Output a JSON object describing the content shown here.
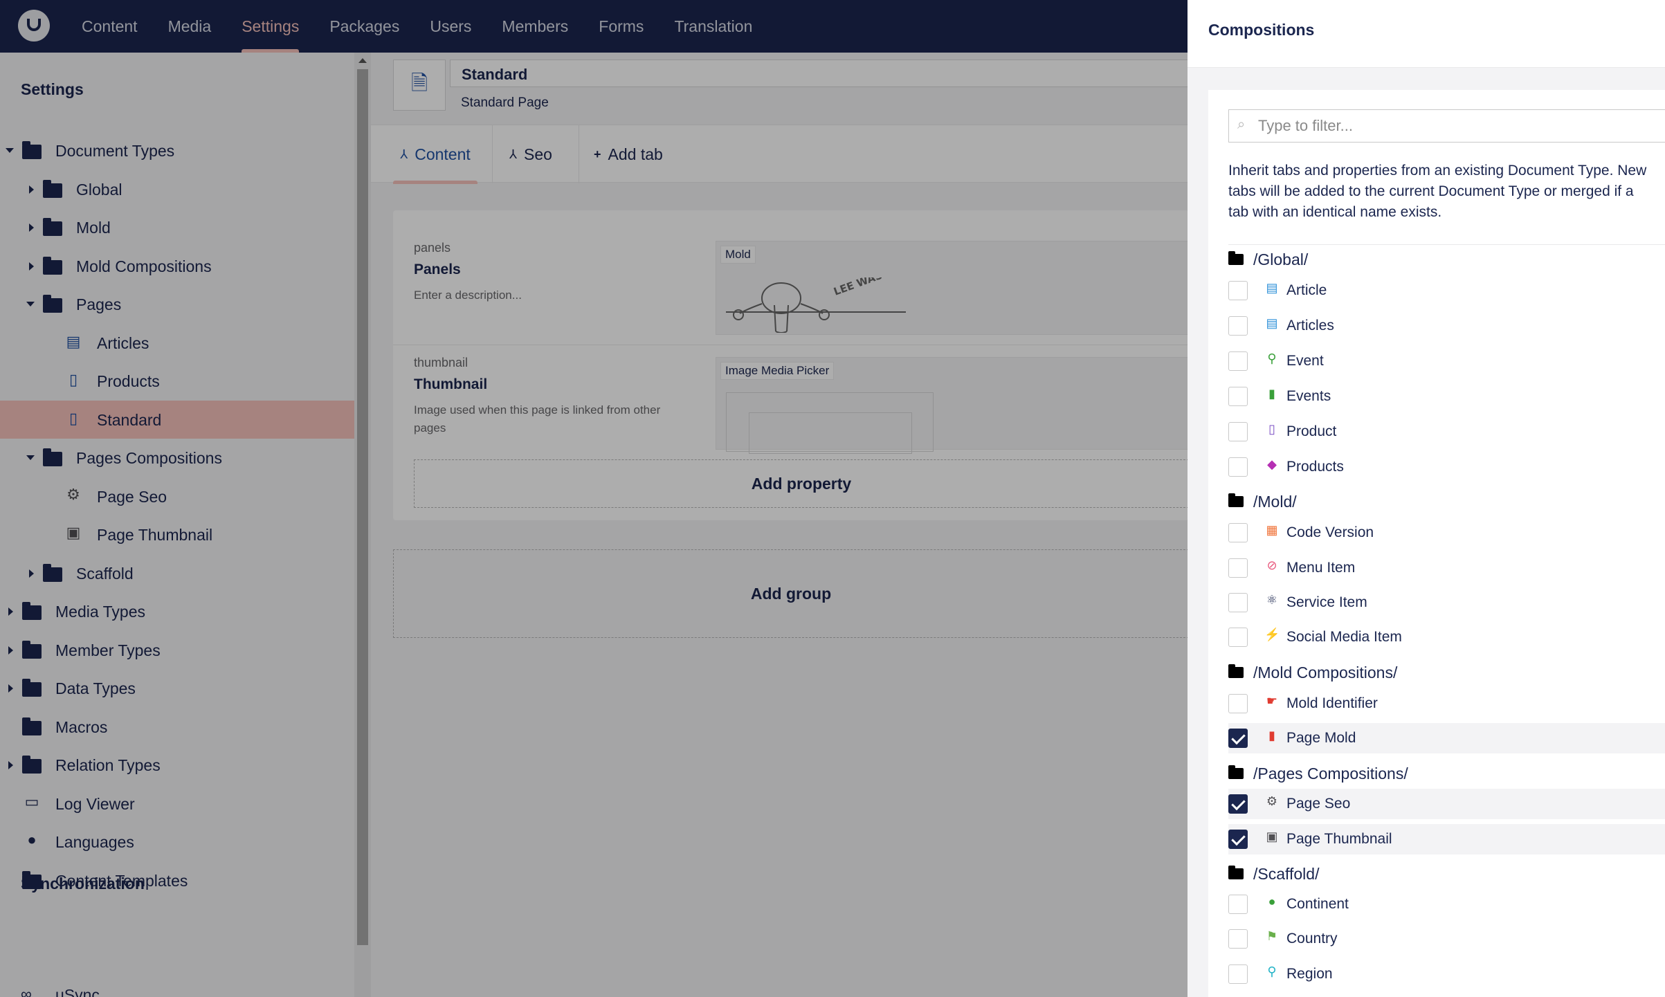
{
  "topnav": {
    "items": [
      {
        "label": "Content"
      },
      {
        "label": "Media"
      },
      {
        "label": "Settings"
      },
      {
        "label": "Packages"
      },
      {
        "label": "Users"
      },
      {
        "label": "Members"
      },
      {
        "label": "Forms"
      },
      {
        "label": "Translation"
      }
    ],
    "active": "Settings"
  },
  "sidebar": {
    "title": "Settings",
    "tree": [
      {
        "label": "Document Types",
        "icon": "folder-icon",
        "expanded": true
      },
      {
        "label": "Global",
        "icon": "folder-icon",
        "expanded": false
      },
      {
        "label": "Mold",
        "icon": "folder-icon",
        "expanded": false
      },
      {
        "label": "Mold Compositions",
        "icon": "folder-icon",
        "expanded": false
      },
      {
        "label": "Pages",
        "icon": "folder-icon",
        "expanded": true
      },
      {
        "label": "Articles",
        "icon": "newspaper-icon"
      },
      {
        "label": "Products",
        "icon": "document-icon"
      },
      {
        "label": "Standard",
        "icon": "document-icon",
        "selected": true
      },
      {
        "label": "Pages Compositions",
        "icon": "folder-icon",
        "expanded": true
      },
      {
        "label": "Page Seo",
        "icon": "gear-icon"
      },
      {
        "label": "Page Thumbnail",
        "icon": "picture-icon"
      },
      {
        "label": "Scaffold",
        "icon": "folder-icon",
        "expanded": false
      },
      {
        "label": "Media Types",
        "icon": "folder-icon",
        "expanded": false
      },
      {
        "label": "Member Types",
        "icon": "folder-icon",
        "expanded": false
      },
      {
        "label": "Data Types",
        "icon": "folder-icon",
        "expanded": false
      },
      {
        "label": "Macros",
        "icon": "folder-icon"
      },
      {
        "label": "Relation Types",
        "icon": "folder-icon",
        "expanded": false
      },
      {
        "label": "Log Viewer",
        "icon": "box-icon"
      },
      {
        "label": "Languages",
        "icon": "globe-icon"
      },
      {
        "label": "Content Templates",
        "icon": "folder-icon"
      }
    ],
    "sync_title": "Synchronization",
    "usync": "uSync"
  },
  "editor": {
    "name": "Standard",
    "alias": "Standard Page",
    "tabs": [
      {
        "label": "Content"
      },
      {
        "label": "Seo"
      },
      {
        "label": "Add tab"
      }
    ],
    "properties": [
      {
        "alias": "panels",
        "name": "Panels",
        "description": "Enter a description...",
        "editor": "Mold",
        "doodle": "LEE WAS HERE"
      },
      {
        "alias": "thumbnail",
        "name": "Thumbnail",
        "description": "Image used when this page is linked from other pages",
        "editor": "Image Media Picker"
      }
    ],
    "add_property": "Add property",
    "add_group": "Add group"
  },
  "panel": {
    "title": "Compositions",
    "filter_placeholder": "Type to filter...",
    "intro": "Inherit tabs and properties from an existing Document Type. New tabs will be added to the current Document Type or merged if a tab with an identical name exists.",
    "groups": [
      {
        "name": "/Global/",
        "items": [
          {
            "label": "Article",
            "icon": "newspaper-icon",
            "color": "#2b8fd8",
            "checked": false
          },
          {
            "label": "Articles",
            "icon": "newspaper-icon",
            "color": "#2b8fd8",
            "checked": false
          },
          {
            "label": "Event",
            "icon": "map-pin-icon",
            "color": "#3aa03a",
            "checked": false
          },
          {
            "label": "Events",
            "icon": "calendar-icon",
            "color": "#3aa03a",
            "checked": false
          },
          {
            "label": "Product",
            "icon": "document-icon",
            "color": "#7b4fc4",
            "checked": false
          },
          {
            "label": "Products",
            "icon": "tags-icon",
            "color": "#b52fb3",
            "checked": false
          }
        ]
      },
      {
        "name": "/Mold/",
        "items": [
          {
            "label": "Code Version",
            "icon": "grid-icon",
            "color": "#f0743a",
            "checked": false
          },
          {
            "label": "Menu Item",
            "icon": "paperclip-icon",
            "color": "#e8577c",
            "checked": false
          },
          {
            "label": "Service Item",
            "icon": "atom-icon",
            "color": "#1b264f",
            "checked": false
          },
          {
            "label": "Social Media Item",
            "icon": "satellite-icon",
            "color": "#e8577c",
            "checked": false
          }
        ]
      },
      {
        "name": "/Mold Compositions/",
        "items": [
          {
            "label": "Mold Identifier",
            "icon": "hand-icon",
            "color": "#e03c31",
            "checked": false
          },
          {
            "label": "Page Mold",
            "icon": "book-icon",
            "color": "#e03c31",
            "checked": true
          }
        ]
      },
      {
        "name": "/Pages Compositions/",
        "items": [
          {
            "label": "Page Seo",
            "icon": "gear-icon",
            "color": "#515054",
            "checked": true
          },
          {
            "label": "Page Thumbnail",
            "icon": "picture-icon",
            "color": "#515054",
            "checked": true
          }
        ]
      },
      {
        "name": "/Scaffold/",
        "items": [
          {
            "label": "Continent",
            "icon": "globe-icon",
            "color": "#3aa03a",
            "checked": false
          },
          {
            "label": "Country",
            "icon": "flag-icon",
            "color": "#6ab04c",
            "checked": false
          },
          {
            "label": "Region",
            "icon": "map-pin-icon",
            "color": "#22b3c7",
            "checked": false
          }
        ]
      }
    ]
  }
}
